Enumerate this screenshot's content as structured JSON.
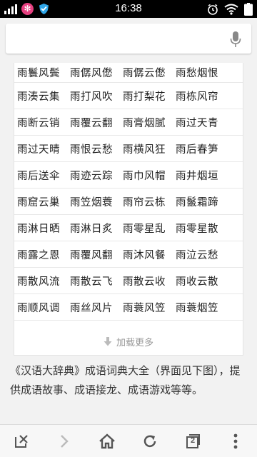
{
  "status_bar": {
    "time": "16:38"
  },
  "search": {
    "placeholder": ""
  },
  "idioms": [
    [
      "雨鬟风鬓",
      "雨僝风僽",
      "雨僝云僽",
      "雨愁烟恨"
    ],
    [
      "雨湊云集",
      "雨打风吹",
      "雨打梨花",
      "雨栋风帘"
    ],
    [
      "雨断云销",
      "雨覆云翻",
      "雨膏烟腻",
      "雨过天青"
    ],
    [
      "雨过天晴",
      "雨恨云愁",
      "雨横风狂",
      "雨后春笋"
    ],
    [
      "雨后送伞",
      "雨迹云踪",
      "雨巾风帽",
      "雨井烟垣"
    ],
    [
      "雨窟云巢",
      "雨笠烟蓑",
      "雨帘云栋",
      "雨鬣霜蹄"
    ],
    [
      "雨淋日晒",
      "雨淋日炙",
      "雨零星乱",
      "雨零星散"
    ],
    [
      "雨露之恩",
      "雨覆风翻",
      "雨沐风餐",
      "雨泣云愁"
    ],
    [
      "雨散风流",
      "雨散云飞",
      "雨散云收",
      "雨收云散"
    ],
    [
      "雨顺风调",
      "雨丝风片",
      "雨蓑风笠",
      "雨蓑烟笠"
    ]
  ],
  "load_more": {
    "label": "加载更多"
  },
  "description": "《汉语大辞典》成语词典大全（界面见下图），提供成语故事、成语接龙、成语游戏等等。",
  "bottom_nav": {
    "tab_count": "2"
  },
  "colors": {
    "status_bar": "#000000",
    "accent_icon": "#e64080",
    "nav_icon": "#555555"
  }
}
